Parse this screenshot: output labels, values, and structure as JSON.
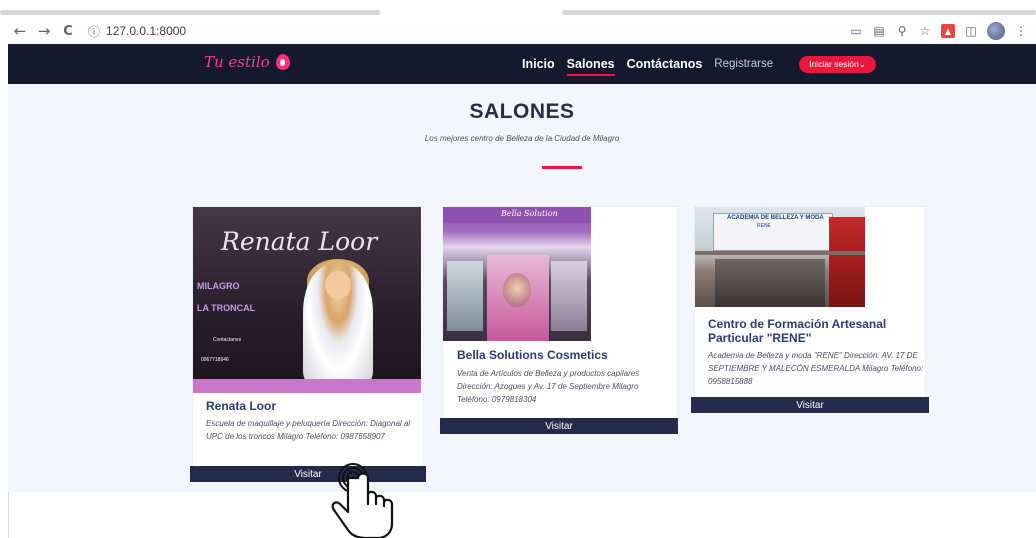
{
  "browser": {
    "url": "127.0.0.1:8000",
    "nav": {
      "back": "←",
      "forward": "→",
      "reload": "C",
      "info": "ⓘ"
    }
  },
  "site": {
    "logo_text": "Tu estilo",
    "nav": [
      "Inicio",
      "Salones",
      "Contáctanos",
      "Registrarse"
    ],
    "active_nav": "Salones",
    "login_button": "Iniciar sesión"
  },
  "page": {
    "title": "SALONES",
    "subtitle": "Los mejores centro de Belleza de la Ciudad de Milagro"
  },
  "salons": [
    {
      "name": "Renata Loor",
      "description": "Escuela de maquillaje y peluquería Dirección: Diagonal al UPC de los troncos Milagro Teléfono: 0987658907",
      "button": "Visitar",
      "image_text": {
        "title": "Renata Loor",
        "line1": "MILAGRO",
        "line2": "LA TRONCAL",
        "contacts": "Contactanos",
        "phone": "0967718946"
      }
    },
    {
      "name": "Bella Solutions Cosmetics",
      "description": "Venta de Artículos de Belleza y productos capilares Dirección: Azogues y Av. 17 de Septiembre Milagro Teléfono: 0979818304",
      "button": "Visitar",
      "image_text": {
        "sign": "Bella Solution"
      }
    },
    {
      "name": "Centro de Formación Artesanal Particular \"RENE\"",
      "description": "Academia de Belleza y moda \"RENE\" Dirección: AV. 17 DE SEPTIEMBRE Y MALECÓN ESMERALDA Milagro Teléfono: 0958815888",
      "button": "Visitar",
      "image_text": {
        "banner": "ACADEMIA DE BELLEZA Y MODA",
        "sub": "RENE"
      }
    }
  ]
}
